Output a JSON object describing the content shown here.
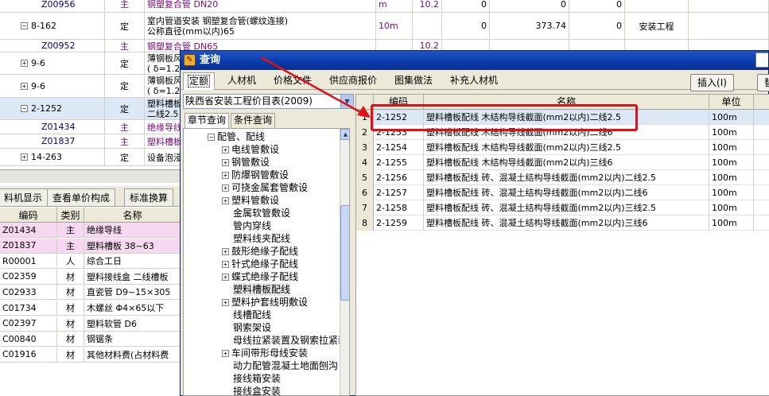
{
  "background": {
    "rows": [
      {
        "code": "Z00956",
        "type": "主",
        "name": "钢塑复合管 DN20",
        "unit": "m",
        "qty": "10.2",
        "c1": "0",
        "c2": "0",
        "c3": "0",
        "remark": "",
        "indent": "sub"
      },
      {
        "code": "8-162",
        "type": "定",
        "name": "室内管道安装 钢塑复合管(螺纹连接)",
        "name2": "公称直径(mm以内)65",
        "unit": "10m",
        "qty": "",
        "c1": "0",
        "c2": "373.74",
        "c3": "0",
        "remark": "安装工程",
        "indent": "minus"
      },
      {
        "code": "Z00952",
        "type": "主",
        "name": "钢塑复合管 DN65",
        "unit": "",
        "qty": "10.2",
        "c1": "",
        "c2": "",
        "c3": "",
        "remark": "",
        "indent": "sub"
      },
      {
        "code": "9-6",
        "type": "定",
        "name": "薄钢板风",
        "name2": "( δ=1.2",
        "indent": "plus"
      },
      {
        "code": "9-6",
        "type": "定",
        "name": "薄钢板风",
        "name2": "( δ=1.2",
        "indent": "plus"
      },
      {
        "code": "2-1252",
        "type": "定",
        "name": "塑料槽板",
        "name2": "二线2.5",
        "indent": "minus",
        "selected": true
      },
      {
        "code": "Z01434",
        "type": "主",
        "name": "绝缘导线",
        "indent": "sub"
      },
      {
        "code": "Z01837",
        "type": "主",
        "name": "塑料槽板",
        "indent": "sub"
      },
      {
        "code": "14-263",
        "type": "定",
        "name": "设备泡浸",
        "indent": "plus"
      }
    ],
    "tabs": [
      "料机显示",
      "查看单价构成",
      "标准换算"
    ],
    "lower_headers": [
      "编码",
      "类别",
      "名称"
    ],
    "lower_rows": [
      {
        "code": "Z01434",
        "type": "主",
        "name": "绝缘导线",
        "pink": true
      },
      {
        "code": "Z01837",
        "type": "主",
        "name": "塑料槽板 38~63",
        "pink": true
      },
      {
        "code": "R00001",
        "type": "人",
        "name": "综合工日"
      },
      {
        "code": "C02359",
        "type": "材",
        "name": "塑料接线盒 二线槽板"
      },
      {
        "code": "C02933",
        "type": "材",
        "name": "直瓷管 D9~15×305"
      },
      {
        "code": "C01734",
        "type": "材",
        "name": "木螺丝 Φ4×65以下"
      },
      {
        "code": "C02397",
        "type": "材",
        "name": "塑料软管 D6"
      },
      {
        "code": "C00840",
        "type": "材",
        "name": "钢锯条"
      },
      {
        "code": "C01916",
        "type": "材",
        "name": "其他材料费(占材料费"
      }
    ]
  },
  "dialog": {
    "title": "查询",
    "icon": "query-icon",
    "tabs": [
      "定额",
      "人材机",
      "价格文件",
      "供应商报价",
      "图集做法",
      "补充人材机"
    ],
    "insert_button": "插入(I)",
    "replace_button": "替",
    "library": "陕西省安装工程价目表(2009)",
    "subtabs": [
      "章节查询",
      "条件查询"
    ],
    "tree": [
      {
        "label": "配管、配线",
        "level": 0,
        "exp": "minus"
      },
      {
        "label": "电线管敷设",
        "level": 1,
        "exp": "plus"
      },
      {
        "label": "钢管敷设",
        "level": 1,
        "exp": "plus"
      },
      {
        "label": "防爆钢管敷设",
        "level": 1,
        "exp": "plus"
      },
      {
        "label": "可挠金属套管敷设",
        "level": 1,
        "exp": "plus"
      },
      {
        "label": "塑料管敷设",
        "level": 1,
        "exp": "plus"
      },
      {
        "label": "金属软管敷设",
        "level": 1,
        "exp": ""
      },
      {
        "label": "管内穿线",
        "level": 1,
        "exp": ""
      },
      {
        "label": "塑料线夹配线",
        "level": 1,
        "exp": ""
      },
      {
        "label": "鼓形绝缘子配线",
        "level": 1,
        "exp": "plus"
      },
      {
        "label": "针式绝缘子配线",
        "level": 1,
        "exp": "plus"
      },
      {
        "label": "蝶式绝缘子配线",
        "level": 1,
        "exp": "plus"
      },
      {
        "label": "塑料槽板配线",
        "level": 1,
        "exp": "",
        "selected": true
      },
      {
        "label": "塑料护套线明敷设",
        "level": 1,
        "exp": "plus"
      },
      {
        "label": "线槽配线",
        "level": 1,
        "exp": ""
      },
      {
        "label": "钢索架设",
        "level": 1,
        "exp": ""
      },
      {
        "label": "母线拉紧装置及钢索拉紧装置",
        "level": 1,
        "exp": ""
      },
      {
        "label": "车间带形母线安装",
        "level": 1,
        "exp": "plus"
      },
      {
        "label": "动力配管混凝土地面刨沟",
        "level": 1,
        "exp": ""
      },
      {
        "label": "接线箱安装",
        "level": 1,
        "exp": ""
      },
      {
        "label": "接线盒安装",
        "level": 1,
        "exp": ""
      }
    ],
    "grid_headers": [
      "编码",
      "名称",
      "单位"
    ],
    "grid_rows": [
      {
        "num": "1",
        "code": "2-1252",
        "name": "塑料槽板配线 木结构导线截面(mm2以内)二线2.5",
        "unit": "100m",
        "selected": true
      },
      {
        "num": "2",
        "code": "2-1253",
        "name": "塑料槽板配线 木结构导线截面(mm2以内)二线6",
        "unit": "100m"
      },
      {
        "num": "3",
        "code": "2-1254",
        "name": "塑料槽板配线 木结构导线截面(mm2以内)三线2.5",
        "unit": "100m"
      },
      {
        "num": "4",
        "code": "2-1255",
        "name": "塑料槽板配线 木结构导线截面(mm2以内)三线6",
        "unit": "100m"
      },
      {
        "num": "5",
        "code": "2-1256",
        "name": "塑料槽板配线 砖、混凝土结构导线截面(mm2以内)二线2.5",
        "unit": "100m"
      },
      {
        "num": "6",
        "code": "2-1257",
        "name": "塑料槽板配线 砖、混凝土结构导线截面(mm2以内)二线6",
        "unit": "100m"
      },
      {
        "num": "7",
        "code": "2-1258",
        "name": "塑料槽板配线 砖、混凝土结构导线截面(mm2以内)三线2.5",
        "unit": "100m"
      },
      {
        "num": "8",
        "code": "2-1259",
        "name": "塑料槽板配线 砖、混凝土结构导线截面(mm2以内)三线6",
        "unit": "100m"
      }
    ]
  },
  "annotation": {
    "color": "#e0101a"
  }
}
